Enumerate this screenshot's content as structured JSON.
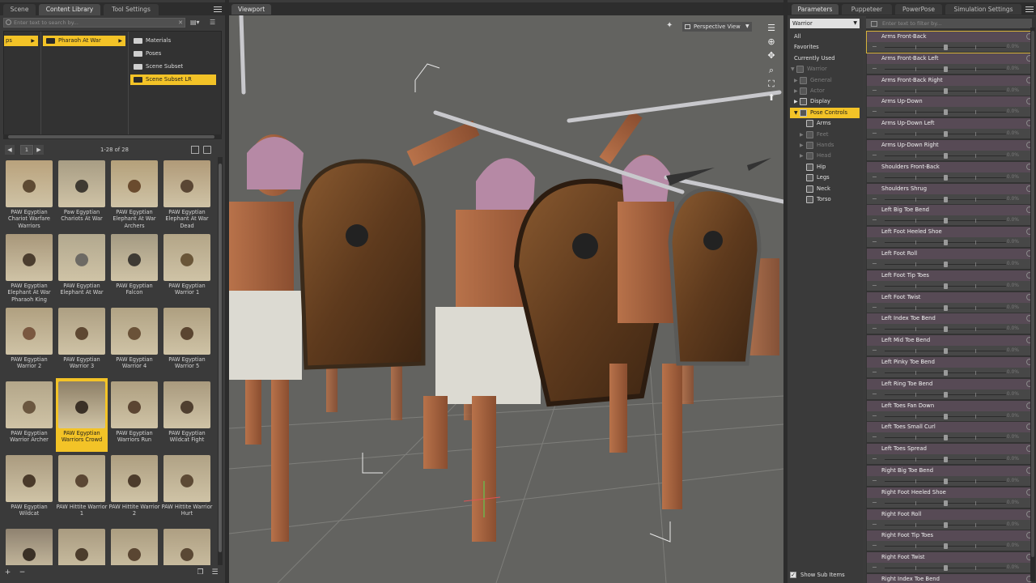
{
  "left_panel": {
    "tabs": [
      "Scene",
      "Content Library",
      "Tool Settings"
    ],
    "active_tab": "Content Library",
    "search_placeholder": "Enter text to search by...",
    "tree": {
      "col1": "ps",
      "col2": "Pharaoh At War",
      "col3": [
        "Materials",
        "Poses",
        "Scene Subset",
        "Scene Subset LR"
      ],
      "selected": "Scene Subset LR"
    },
    "nav": {
      "page": "1",
      "count": "1-28 of 28"
    },
    "items": [
      "PAW Egyptian Chariot Warfare Warriors",
      "Paw Egyptian Chariots At War",
      "PAW Egyptian Elephant At War Archers",
      "PAW Egyptian Elephant At War Dead",
      "PAW Egyptian Elephant At War Pharaoh King",
      "PAW Egyptian Elephant At War",
      "PAW Egyptian Falcon",
      "PAW Egyptian Warrior 1",
      "PAW Egyptian Warrior 2",
      "PAW Egyptian Warrior 3",
      "PAW Egyptian Warrior 4",
      "PAW Egyptian Warrior 5",
      "PAW Egyptian Warrior Archer",
      "PAW Egyptian Warriors Crowd",
      "PAW Egyptian Warriors Run",
      "PAW Egyptian Wildcat Fight",
      "PAW Egyptian Wildcat",
      "PAW Hittite Warrior 1",
      "PAW Hittite Warrior 2",
      "PAW Hittite Warrior Hurt",
      "",
      "",
      "",
      ""
    ],
    "selected_item": "PAW Egyptian Warriors Crowd"
  },
  "viewport": {
    "tab": "Viewport",
    "camera": "Perspective View"
  },
  "right_panel": {
    "tabs": [
      "Parameters",
      "Puppeteer",
      "PowerPose",
      "Simulation Settings"
    ],
    "active_tab": "Parameters",
    "node_dropdown": "Warrior",
    "filter_placeholder": "Enter text to filter by...",
    "tree": [
      {
        "label": "All",
        "indent": 0,
        "type": "plain"
      },
      {
        "label": "Favorites",
        "indent": 0,
        "type": "plain"
      },
      {
        "label": "Currently Used",
        "indent": 0,
        "type": "plain"
      },
      {
        "label": "Warrior",
        "indent": 0,
        "type": "figure",
        "dim": true
      },
      {
        "label": "General",
        "indent": 1,
        "type": "group",
        "dim": true
      },
      {
        "label": "Actor",
        "indent": 1,
        "type": "group",
        "dim": true
      },
      {
        "label": "Display",
        "indent": 1,
        "type": "group"
      },
      {
        "label": "Pose Controls",
        "indent": 1,
        "type": "group",
        "selected": true
      },
      {
        "label": "Arms",
        "indent": 2,
        "type": "group"
      },
      {
        "label": "Feet",
        "indent": 2,
        "type": "group",
        "dim": true
      },
      {
        "label": "Hands",
        "indent": 2,
        "type": "group",
        "dim": true
      },
      {
        "label": "Head",
        "indent": 2,
        "type": "group",
        "dim": true
      },
      {
        "label": "Hip",
        "indent": 2,
        "type": "group"
      },
      {
        "label": "Legs",
        "indent": 2,
        "type": "group"
      },
      {
        "label": "Neck",
        "indent": 2,
        "type": "group"
      },
      {
        "label": "Torso",
        "indent": 2,
        "type": "group"
      }
    ],
    "show_sub_items": "Show Sub Items",
    "properties": [
      {
        "name": "Arms Front-Back",
        "value": "0.0%"
      },
      {
        "name": "Arms Front-Back Left",
        "value": "0.0%"
      },
      {
        "name": "Arms Front-Back Right",
        "value": "0.0%"
      },
      {
        "name": "Arms Up-Down",
        "value": "0.0%"
      },
      {
        "name": "Arms Up-Down Left",
        "value": "0.0%"
      },
      {
        "name": "Arms Up-Down Right",
        "value": "0.0%"
      },
      {
        "name": "Shoulders Front-Back",
        "value": "0.0%"
      },
      {
        "name": "Shoulders Shrug",
        "value": "0.0%"
      },
      {
        "name": "Left Big Toe Bend",
        "value": "0.0%"
      },
      {
        "name": "Left Foot Heeled Shoe",
        "value": "0.0%"
      },
      {
        "name": "Left Foot Roll",
        "value": "0.0%"
      },
      {
        "name": "Left Foot Tip Toes",
        "value": "0.0%"
      },
      {
        "name": "Left Foot Twist",
        "value": "0.0%"
      },
      {
        "name": "Left Index Toe Bend",
        "value": "0.0%"
      },
      {
        "name": "Left Mid Toe Bend",
        "value": "0.0%"
      },
      {
        "name": "Left Pinky Toe Bend",
        "value": "0.0%"
      },
      {
        "name": "Left Ring Toe Bend",
        "value": "0.0%"
      },
      {
        "name": "Left Toes Fan Down",
        "value": "0.0%"
      },
      {
        "name": "Left Toes Small Curl",
        "value": "0.0%"
      },
      {
        "name": "Left Toes Spread",
        "value": "0.0%"
      },
      {
        "name": "Right Big Toe Bend",
        "value": "0.0%"
      },
      {
        "name": "Right Foot Heeled Shoe",
        "value": "0.0%"
      },
      {
        "name": "Right Foot Roll",
        "value": "0.0%"
      },
      {
        "name": "Right Foot Tip Toes",
        "value": "0.0%"
      },
      {
        "name": "Right Foot Twist",
        "value": "0.0%"
      },
      {
        "name": "Right Index Toe Bend",
        "value": "0.0%"
      }
    ]
  },
  "colors": {
    "accent": "#f3c327",
    "panel_bg": "#3a3a3a",
    "slider_header": "#574a55",
    "viewport_bg": "#636360"
  }
}
